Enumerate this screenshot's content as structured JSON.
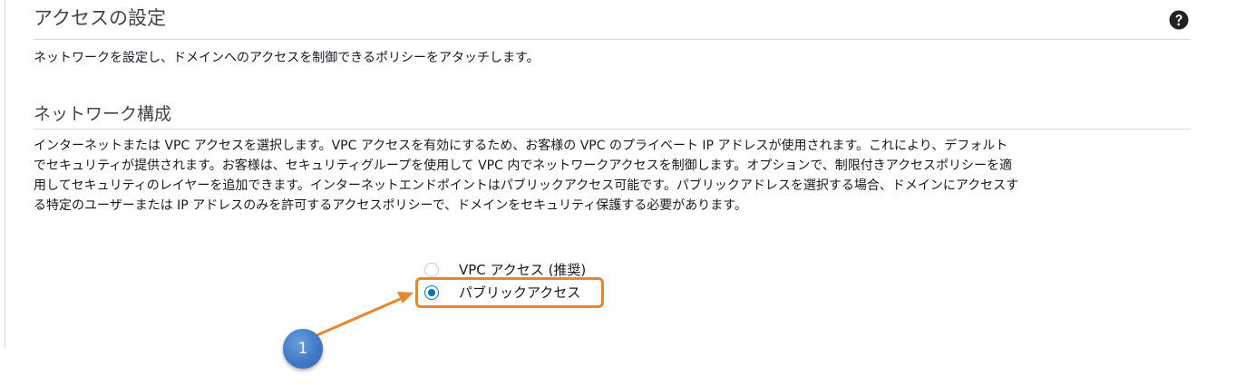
{
  "section": {
    "title": "アクセスの設定",
    "description": "ネットワークを設定し、ドメインへのアクセスを制御できるポリシーをアタッチします。"
  },
  "network": {
    "title": "ネットワーク構成",
    "body_lines": [
      "インターネットまたは VPC アクセスを選択します。VPC アクセスを有効にするため、お客様の VPC のプライベート IP アドレスが使用されます。これにより、デフォルト",
      "でセキュリティが提供されます。お客様は、セキュリティグループを使用して VPC 内でネットワークアクセスを制御します。オプションで、制限付きアクセスポリシーを適",
      "用してセキュリティのレイヤーを追加できます。インターネットエンドポイントはパブリックアクセス可能です。パブリックアドレスを選択する場合、ドメインにアクセスす",
      "る特定のユーザーまたは IP アドレスのみを許可するアクセスポリシーで、ドメインをセキュリティ保護する必要があります。"
    ],
    "options": [
      {
        "label": "VPC アクセス (推奨)",
        "selected": false
      },
      {
        "label": "パブリックアクセス",
        "selected": true
      }
    ]
  },
  "annotation": {
    "step_number": "1",
    "highlight_color": "#e8862d",
    "callout_color": "#3f76c4"
  },
  "icons": {
    "help": "help-circle-icon"
  },
  "colors": {
    "radio_selected": "#0073bb",
    "heading": "#444444"
  }
}
